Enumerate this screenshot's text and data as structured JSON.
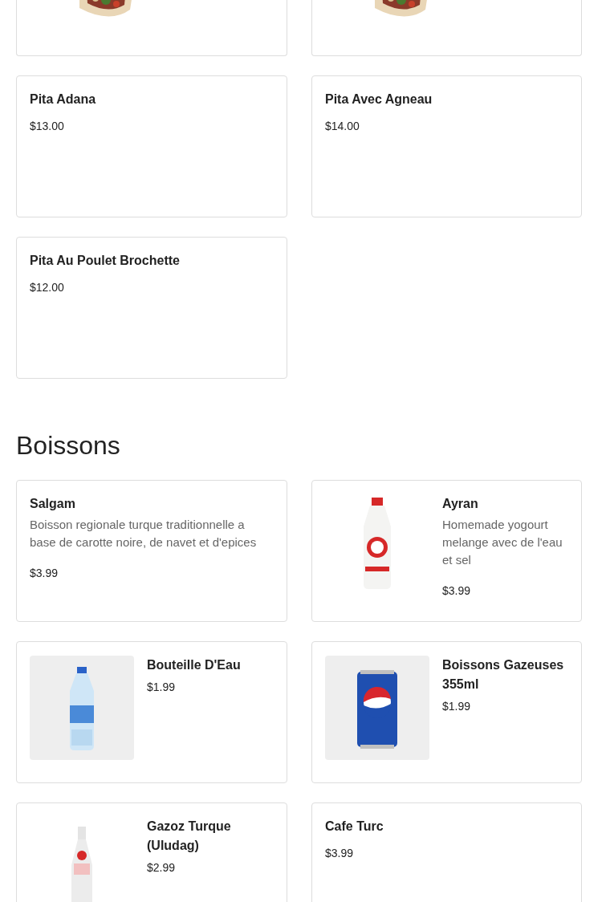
{
  "sections": [
    {
      "items": [
        {
          "image": {
            "kind": "picture"
          }
        },
        {
          "image": {
            "kind": "picture"
          }
        },
        {
          "name": "Pita Adana",
          "price": "$13.00"
        },
        {
          "name": "Pita Avec Agneau",
          "price": "$14.00"
        },
        {
          "name": "Pita Au Poulet Brochette",
          "price": "$12.00"
        }
      ]
    },
    {
      "title": "Boissons",
      "items": [
        {
          "name": "Salgam",
          "description": "Boisson regionale turque traditionnelle a base de carotte noire, de navet et d'epices",
          "price": "$3.99"
        },
        {
          "name": "Ayran",
          "description": "Homemade yogourt melange avec de l'eau et sel",
          "price": "$3.99",
          "image": {
            "kind": "picture"
          }
        },
        {
          "name": "Bouteille D'Eau",
          "price": "$1.99",
          "image": {
            "kind": "picture"
          }
        },
        {
          "name": "Boissons Gazeuses 355ml",
          "price": "$1.99",
          "image": {
            "kind": "picture"
          }
        },
        {
          "name": "Gazoz Turque (Uludag)",
          "price": "$2.99",
          "image": {
            "kind": "picture"
          }
        },
        {
          "name": "Cafe Turc",
          "price": "$3.99"
        }
      ]
    }
  ]
}
